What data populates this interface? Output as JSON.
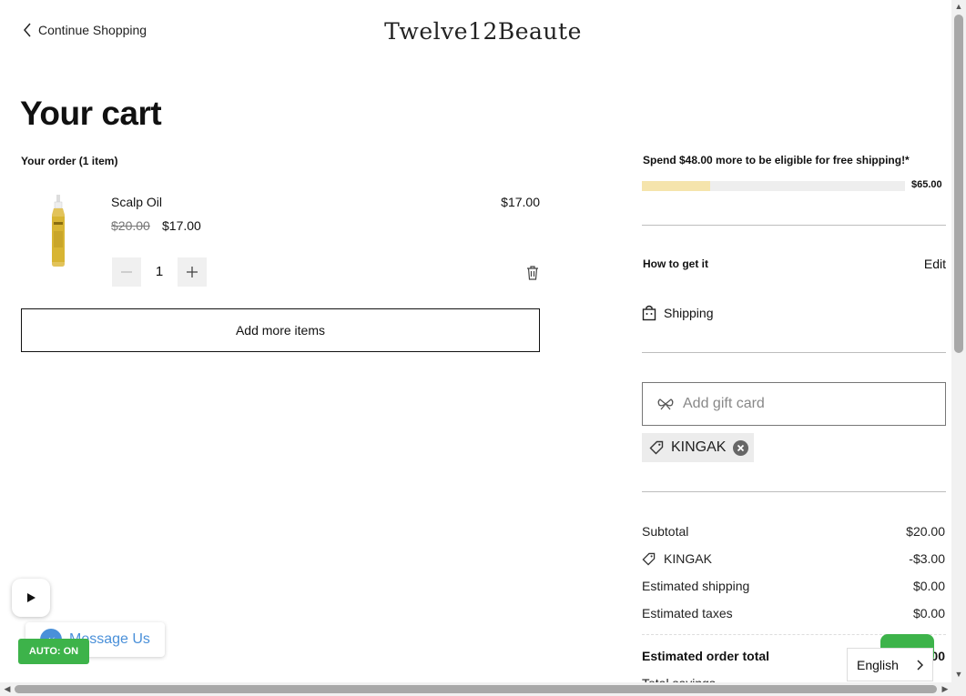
{
  "header": {
    "continue_label": "Continue Shopping",
    "brand": "Twelve12Beaute"
  },
  "cart": {
    "title": "Your cart",
    "order_count": "Your order (1 item)",
    "items": [
      {
        "name": "Scalp Oil",
        "line_total": "$17.00",
        "original_price": "$20.00",
        "sale_price": "$17.00",
        "quantity": "1"
      }
    ],
    "add_more_label": "Add more items"
  },
  "sidebar": {
    "free_shipping_msg": "Spend $48.00 more to be eligible for free shipping!*",
    "free_shipping_target": "$65.00",
    "free_shipping_progress": 0.26,
    "how_to_get_label": "How to get it",
    "edit_label": "Edit",
    "shipping_method": "Shipping",
    "gift_card_placeholder": "Add gift card",
    "coupon_code": "KINGAK"
  },
  "summary": {
    "subtotal_label": "Subtotal",
    "subtotal_value": "$20.00",
    "discount_label": "KINGAK",
    "discount_value": "-$3.00",
    "shipping_label": "Estimated shipping",
    "shipping_value": "$0.00",
    "taxes_label": "Estimated taxes",
    "taxes_value": "$0.00",
    "total_label": "Estimated order total",
    "total_value": "00",
    "savings_label": "Total savings"
  },
  "widgets": {
    "message_us": "Message Us",
    "auto_toggle": "AUTO: ON",
    "language": "English"
  },
  "colors": {
    "progress_fill": "#f5e4ac",
    "accent_green": "#3db34a",
    "messenger_blue": "#4a90d9"
  }
}
